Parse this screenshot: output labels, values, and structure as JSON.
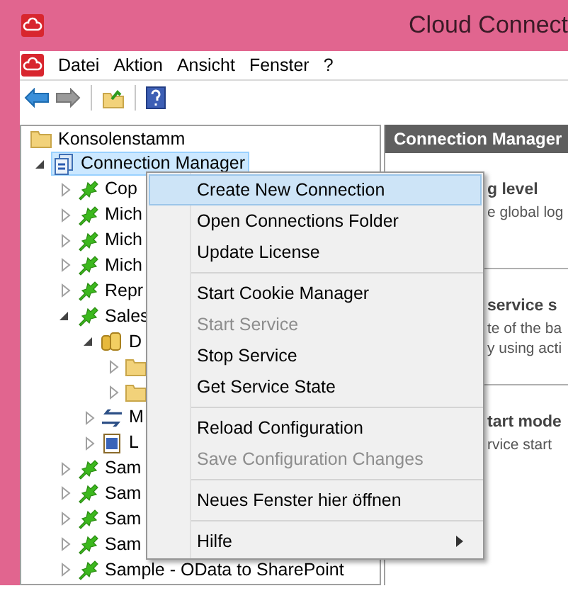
{
  "window": {
    "title": "Cloud Connect"
  },
  "menu_bar": [
    "Datei",
    "Aktion",
    "Ansicht",
    "Fenster",
    "?"
  ],
  "tree": [
    {
      "label": "Konsolenstamm",
      "kind": "folder",
      "selected": false,
      "children": [
        {
          "label": "Connection Manager",
          "kind": "manager",
          "selected": true,
          "expanded": true,
          "children": [
            {
              "label": "Cop",
              "kind": "plug",
              "selected": false,
              "expanded": false
            },
            {
              "label": "Mich",
              "kind": "plug",
              "selected": false,
              "expanded": false
            },
            {
              "label": "Mich",
              "kind": "plug",
              "selected": false,
              "expanded": false
            },
            {
              "label": "Mich",
              "kind": "plug",
              "selected": false,
              "expanded": false
            },
            {
              "label": "Repr",
              "kind": "plug",
              "selected": false,
              "expanded": false
            },
            {
              "label": "Sales",
              "kind": "plug",
              "selected": false,
              "expanded": true,
              "children": [
                {
                  "label": "D",
                  "kind": "database",
                  "selected": false,
                  "expanded": true,
                  "children": [
                    {
                      "kind": "folder",
                      "selected": false,
                      "expanded": false
                    },
                    {
                      "kind": "folder",
                      "selected": false,
                      "expanded": false
                    }
                  ]
                },
                {
                  "label": "M",
                  "kind": "mapping",
                  "selected": false,
                  "expanded": false
                },
                {
                  "label": "L",
                  "kind": "help",
                  "selected": false,
                  "expanded": false
                }
              ]
            },
            {
              "label": "Sam",
              "kind": "plug",
              "selected": false,
              "expanded": false
            },
            {
              "label": "Sam",
              "kind": "plug",
              "selected": false,
              "expanded": false
            },
            {
              "label": "Sam",
              "kind": "plug",
              "selected": false,
              "expanded": false
            },
            {
              "label": "Sam",
              "kind": "plug",
              "selected": false,
              "expanded": false
            },
            {
              "label": "Sample - OData to SharePoint",
              "kind": "plug",
              "selected": false,
              "expanded": false
            }
          ]
        }
      ]
    }
  ],
  "panel": {
    "header": "Connection Manager",
    "sections": [
      {
        "heading": "g level",
        "lines": [
          "e global log"
        ]
      },
      {
        "heading": "service s",
        "lines": [
          "te of the ba",
          "y using acti"
        ]
      },
      {
        "heading": "tart mode",
        "lines": [
          "rvice start"
        ]
      }
    ]
  },
  "context_menu": [
    {
      "kind": "item",
      "label": "Create New Connection",
      "selected": true,
      "disabled": false
    },
    {
      "kind": "item",
      "label": "Open Connections Folder",
      "selected": false,
      "disabled": false
    },
    {
      "kind": "item",
      "label": "Update License",
      "selected": false,
      "disabled": false
    },
    {
      "kind": "separator"
    },
    {
      "kind": "item",
      "label": "Start Cookie Manager",
      "selected": false,
      "disabled": false
    },
    {
      "kind": "item",
      "label": "Start Service",
      "selected": false,
      "disabled": true
    },
    {
      "kind": "item",
      "label": "Stop Service",
      "selected": false,
      "disabled": false
    },
    {
      "kind": "item",
      "label": "Get Service State",
      "selected": false,
      "disabled": false
    },
    {
      "kind": "separator"
    },
    {
      "kind": "item",
      "label": "Reload Configuration",
      "selected": false,
      "disabled": false
    },
    {
      "kind": "item",
      "label": "Save Configuration Changes",
      "selected": false,
      "disabled": true
    },
    {
      "kind": "separator"
    },
    {
      "kind": "item",
      "label": "Neues Fenster hier öffnen",
      "selected": false,
      "disabled": false
    },
    {
      "kind": "separator"
    },
    {
      "kind": "submenu",
      "label": "Hilfe",
      "selected": false,
      "disabled": false
    }
  ]
}
